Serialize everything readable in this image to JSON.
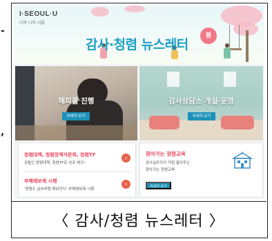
{
  "logo": {
    "brand": "I·SEOUL·U",
    "sub": "너와 나의 서울"
  },
  "newsletter": {
    "title": "감사·청렴 뉴스레터",
    "season_badge": "봄"
  },
  "cards": [
    {
      "title": "해피콜 진행",
      "button": "자세히 보기"
    },
    {
      "title": "감사상담소 개설·운영",
      "button": "자세히 보기"
    }
  ],
  "list_items": [
    {
      "title": "청렴대책, 청렴정책자문회, 청렴TF",
      "desc": "공들인 청렴대책, 청렴TF로 성과 체크!"
    },
    {
      "title": "부패예보제 시행",
      "desc": "'청렴도 날씨처럼 예보한다' 부패예보제 시행"
    }
  ],
  "right_box": {
    "title": "찾아가는 청렴교육",
    "desc_line1": "감사실무자가 직접 들려주는",
    "desc_line2": "찾아가는 청렴교육",
    "button": "자세히 보기"
  },
  "caption": "〈 감사/청렴 뉴스레터 〉",
  "colors": {
    "accent_blue": "#1c9fc4",
    "button_blue": "#1d92b9",
    "accent_pink": "#f2798a",
    "item_red": "#e8455b",
    "arrow_orange": "#e9624a"
  },
  "icons": [
    "arrow-right-icon",
    "school-building-icon"
  ]
}
